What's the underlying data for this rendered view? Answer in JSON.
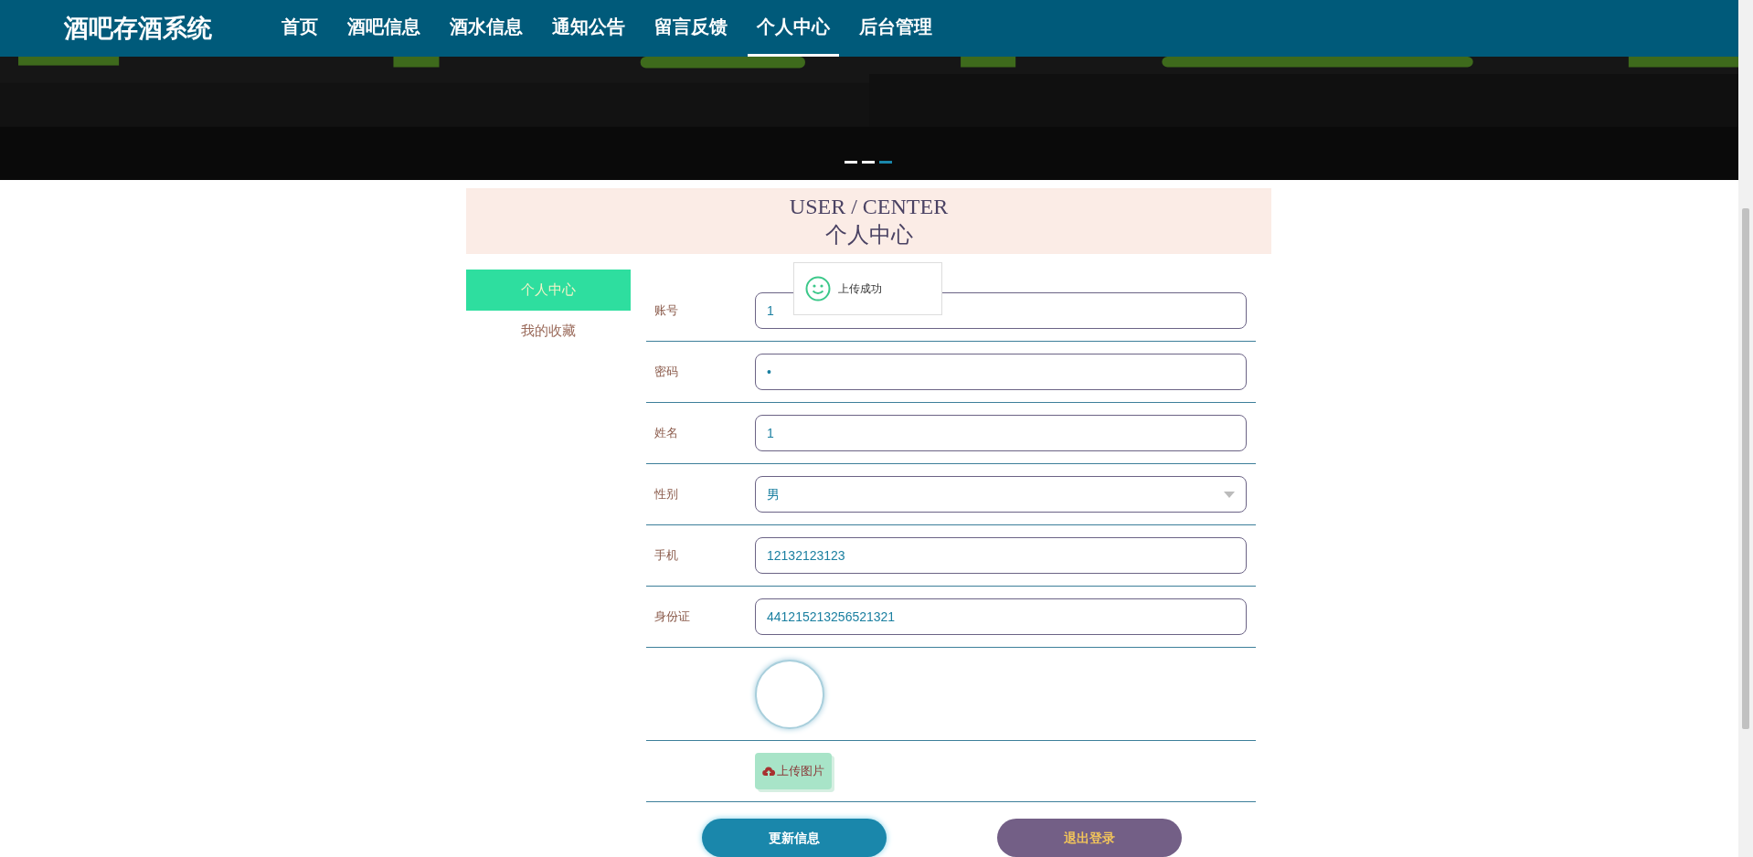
{
  "header": {
    "logo": "酒吧存酒系统",
    "nav": [
      {
        "label": "首页",
        "selected": false
      },
      {
        "label": "酒吧信息",
        "selected": false
      },
      {
        "label": "酒水信息",
        "selected": false
      },
      {
        "label": "通知公告",
        "selected": false
      },
      {
        "label": "留言反馈",
        "selected": false
      },
      {
        "label": "个人中心",
        "selected": true
      },
      {
        "label": "后台管理",
        "selected": false
      }
    ]
  },
  "banner": {
    "kind": "picture",
    "dots": [
      {
        "selected": false
      },
      {
        "selected": false
      },
      {
        "selected": true
      }
    ]
  },
  "title": {
    "en": "USER / CENTER",
    "zh": "个人中心"
  },
  "sidebar": {
    "items": [
      {
        "label": "个人中心",
        "selected": true
      },
      {
        "label": "我的收藏",
        "selected": false
      }
    ]
  },
  "form": {
    "fields": [
      {
        "kind": "input",
        "label": "账号",
        "value": "1"
      },
      {
        "kind": "input",
        "label": "密码",
        "value": "•"
      },
      {
        "kind": "input",
        "label": "姓名",
        "value": "1"
      },
      {
        "kind": "select",
        "label": "性别",
        "value": "男"
      },
      {
        "kind": "input",
        "label": "手机",
        "value": "12132123123"
      },
      {
        "kind": "input",
        "label": "身份证",
        "value": "441215213256521321"
      },
      {
        "kind": "avatar"
      },
      {
        "kind": "upload",
        "button": "上传图片"
      }
    ],
    "buttons": [
      "更新信息",
      "退出登录"
    ]
  },
  "toast": {
    "message": "上传成功"
  }
}
